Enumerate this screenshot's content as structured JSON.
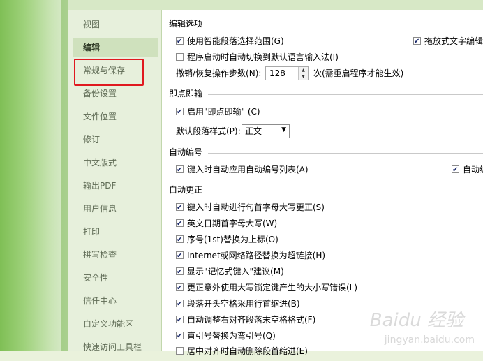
{
  "sidebar": {
    "items": [
      {
        "label": "视图"
      },
      {
        "label": "编辑"
      },
      {
        "label": "常规与保存"
      },
      {
        "label": "备份设置"
      },
      {
        "label": "文件位置"
      },
      {
        "label": "修订"
      },
      {
        "label": "中文版式"
      },
      {
        "label": "输出PDF"
      },
      {
        "label": "用户信息"
      },
      {
        "label": "打印"
      },
      {
        "label": "拼写检查"
      },
      {
        "label": "安全性"
      },
      {
        "label": "信任中心"
      },
      {
        "label": "自定义功能区"
      },
      {
        "label": "快速访问工具栏"
      }
    ],
    "selected": "编辑",
    "highlighted": "常规与保存"
  },
  "sections": {
    "edit_options": {
      "title": "编辑选项",
      "smart_select": {
        "label": "使用智能段落选择范围(G)",
        "checked": true
      },
      "drag_drop": {
        "label": "拖放式文字编辑",
        "checked": true
      },
      "auto_ime": {
        "label": "程序启动时自动切换到默认语言输入法(I)",
        "checked": false
      },
      "undo_label": "撤销/恢复操作步数(N):",
      "undo_value": "128",
      "undo_note": "次(需重启程序才能生效)"
    },
    "click_type": {
      "title": "即点即输",
      "enable": {
        "label": "启用\"即点即输\" (C)",
        "checked": true
      },
      "style_label": "默认段落样式(P):",
      "style_value": "正文"
    },
    "auto_number": {
      "title": "自动编号",
      "auto_list": {
        "label": "键入时自动应用自动编号列表(A)",
        "checked": true
      },
      "right_truncated": {
        "label": "自动编",
        "checked": true
      }
    },
    "auto_correct": {
      "title": "自动更正",
      "items": [
        {
          "label": "键入时自动进行句首字母大写更正(S)",
          "checked": true
        },
        {
          "label": "英文日期首字母大写(W)",
          "checked": true
        },
        {
          "label": "序号(1st)替换为上标(O)",
          "checked": true
        },
        {
          "label": "Internet或网络路径替换为超链接(H)",
          "checked": true
        },
        {
          "label": "显示\"记忆式键入\"建议(M)",
          "checked": true
        },
        {
          "label": "更正意外使用大写锁定键产生的大小写错误(L)",
          "checked": true
        },
        {
          "label": "段落开头空格采用行首缩进(B)",
          "checked": true
        },
        {
          "label": "自动调整右对齐段落末空格格式(F)",
          "checked": true
        },
        {
          "label": "直引号替换为弯引号(Q)",
          "checked": true
        },
        {
          "label": "居中对齐时自动删除段首缩进(E)",
          "checked": false
        }
      ]
    }
  },
  "watermark": {
    "text": "Baidu 经验",
    "sub": "jingyan.baidu.com"
  }
}
